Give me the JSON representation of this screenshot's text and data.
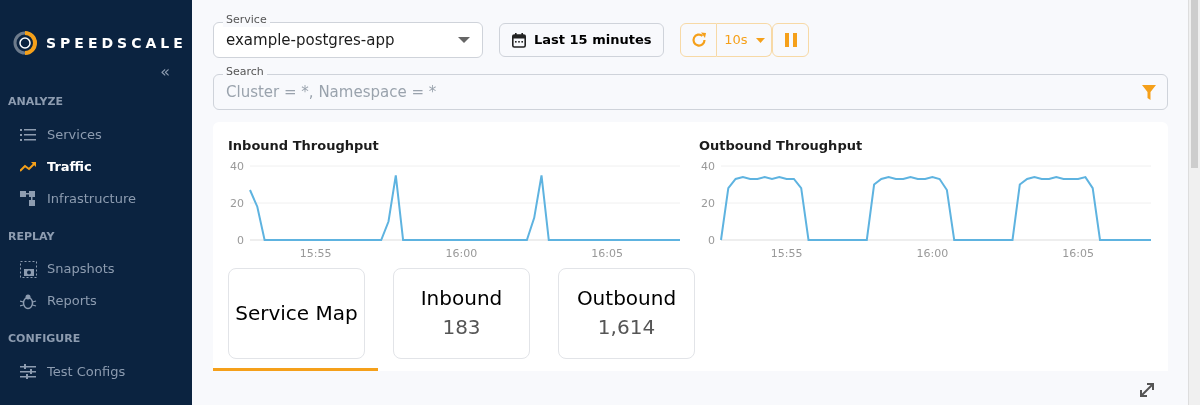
{
  "sidebar": {
    "brand": "SPEEDSCALE",
    "collapse": "«",
    "sections": [
      {
        "title": "ANALYZE",
        "items": [
          {
            "label": "Services",
            "selected": false
          },
          {
            "label": "Traffic",
            "selected": true
          },
          {
            "label": "Infrastructure",
            "selected": false
          }
        ]
      },
      {
        "title": "REPLAY",
        "items": [
          {
            "label": "Snapshots",
            "selected": false
          },
          {
            "label": "Reports",
            "selected": false
          }
        ]
      },
      {
        "title": "CONFIGURE",
        "items": [
          {
            "label": "Test Configs",
            "selected": false
          }
        ]
      }
    ]
  },
  "filters": {
    "service": {
      "label": "Service",
      "value": "example-postgres-app"
    },
    "time_range": "Last 15 minutes",
    "refresh_interval": "10s",
    "search": {
      "label": "Search",
      "placeholder": "Cluster = *, Namespace = *"
    }
  },
  "charts": [
    {
      "chart_data": {
        "type": "line",
        "title": "Inbound Throughput",
        "categories": [
          null,
          null,
          null,
          null,
          null,
          null,
          null,
          null,
          null,
          "15:55",
          null,
          null,
          null,
          null,
          null,
          null,
          null,
          null,
          null,
          null,
          null,
          null,
          null,
          null,
          null,
          null,
          null,
          null,
          null,
          "16:00",
          null,
          null,
          null,
          null,
          null,
          null,
          null,
          null,
          null,
          null,
          null,
          null,
          null,
          null,
          null,
          null,
          null,
          null,
          null,
          "16:05",
          null,
          null,
          null,
          null,
          null,
          null,
          null,
          null,
          null,
          null
        ],
        "series": [
          {
            "color": "#5eb3e0",
            "values": [
              27,
              18,
              0,
              0,
              0,
              0,
              0,
              0,
              0,
              0,
              0,
              0,
              0,
              0,
              0,
              0,
              0,
              0,
              0,
              10,
              35,
              0,
              0,
              0,
              0,
              0,
              0,
              0,
              0,
              0,
              0,
              0,
              0,
              0,
              0,
              0,
              0,
              0,
              0,
              12,
              35,
              0,
              0,
              0,
              0,
              0,
              0,
              0,
              0,
              0,
              0,
              0,
              0,
              0,
              0,
              0,
              0,
              0,
              0,
              0
            ]
          }
        ],
        "ylim": [
          0,
          40
        ],
        "yticks": [
          0,
          20,
          40
        ]
      }
    },
    {
      "chart_data": {
        "type": "line",
        "title": "Outbound Throughput",
        "categories": [
          null,
          null,
          null,
          null,
          null,
          null,
          null,
          null,
          null,
          "15:55",
          null,
          null,
          null,
          null,
          null,
          null,
          null,
          null,
          null,
          null,
          null,
          null,
          null,
          null,
          null,
          null,
          null,
          null,
          null,
          "16:00",
          null,
          null,
          null,
          null,
          null,
          null,
          null,
          null,
          null,
          null,
          null,
          null,
          null,
          null,
          null,
          null,
          null,
          null,
          null,
          "16:05",
          null,
          null,
          null,
          null,
          null,
          null,
          null,
          null,
          null,
          null
        ],
        "series": [
          {
            "color": "#5eb3e0",
            "values": [
              0,
              28,
              33,
              34,
              33,
              33,
              34,
              33,
              34,
              33,
              33,
              28,
              0,
              0,
              0,
              0,
              0,
              0,
              0,
              0,
              0,
              30,
              33,
              34,
              33,
              33,
              34,
              33,
              33,
              34,
              33,
              27,
              0,
              0,
              0,
              0,
              0,
              0,
              0,
              0,
              0,
              30,
              33,
              34,
              33,
              33,
              34,
              33,
              33,
              33,
              34,
              28,
              0,
              0,
              0,
              0,
              0,
              0,
              0,
              0
            ]
          }
        ],
        "ylim": [
          0,
          40
        ],
        "yticks": [
          0,
          20,
          40
        ]
      }
    }
  ],
  "tiles": [
    {
      "title": "Service Map",
      "selected": true
    },
    {
      "title": "Inbound",
      "count": "183",
      "selected": false
    },
    {
      "title": "Outbound",
      "count": "1,614",
      "selected": false
    }
  ]
}
